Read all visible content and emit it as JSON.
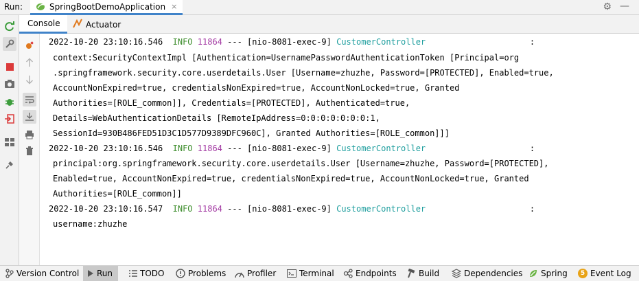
{
  "run_header": {
    "label": "Run:",
    "tab_title": "SpringBootDemoApplication",
    "close_glyph": "×"
  },
  "sub_tabs": [
    {
      "label": "Console",
      "icon": ""
    },
    {
      "label": "Actuator",
      "icon": "actuator-icon"
    }
  ],
  "log": [
    {
      "date": "2022-10-20 23:10:16.546",
      "level": "INFO",
      "pid": "11864",
      "sep": "---",
      "thread": "[nio-8081-exec-9]",
      "logger": "CustomerController",
      "colon": ":"
    },
    {
      "text": "context:SecurityContextImpl [Authentication=UsernamePasswordAuthenticationToken [Principal=org"
    },
    {
      "text": ".springframework.security.core.userdetails.User [Username=zhuzhe, Password=[PROTECTED], Enabled=true,"
    },
    {
      "text": "AccountNonExpired=true, credentialsNonExpired=true, AccountNonLocked=true, Granted"
    },
    {
      "text": "Authorities=[ROLE_common]], Credentials=[PROTECTED], Authenticated=true,"
    },
    {
      "text": "Details=WebAuthenticationDetails [RemoteIpAddress=0:0:0:0:0:0:0:1,"
    },
    {
      "text": "SessionId=930B486FED51D3C1D577D9389DFC960C], Granted Authorities=[ROLE_common]]]"
    },
    {
      "date": "2022-10-20 23:10:16.546",
      "level": "INFO",
      "pid": "11864",
      "sep": "---",
      "thread": "[nio-8081-exec-9]",
      "logger": "CustomerController",
      "colon": ":"
    },
    {
      "text": "principal:org.springframework.security.core.userdetails.User [Username=zhuzhe, Password=[PROTECTED],"
    },
    {
      "text": "Enabled=true, AccountNonExpired=true, credentialsNonExpired=true, AccountNonLocked=true, Granted"
    },
    {
      "text": "Authorities=[ROLE_common]]"
    },
    {
      "date": "2022-10-20 23:10:16.547",
      "level": "INFO",
      "pid": "11864",
      "sep": "---",
      "thread": "[nio-8081-exec-9]",
      "logger": "CustomerController",
      "colon": ":"
    },
    {
      "text": "username:zhuzhe"
    }
  ],
  "bottom_bar": [
    {
      "label": "Version Control",
      "icon": "branch-icon"
    },
    {
      "label": "Run",
      "icon": "play-icon",
      "active": true
    },
    {
      "label": "TODO",
      "icon": "list-icon"
    },
    {
      "label": "Problems",
      "icon": "problems-icon"
    },
    {
      "label": "Profiler",
      "icon": "profiler-icon"
    },
    {
      "label": "Terminal",
      "icon": "terminal-icon"
    },
    {
      "label": "Endpoints",
      "icon": "endpoints-icon"
    },
    {
      "label": "Build",
      "icon": "hammer-icon"
    },
    {
      "label": "Dependencies",
      "icon": "layers-icon"
    },
    {
      "label": "Spring",
      "icon": "spring-leaf-icon"
    },
    {
      "label": "Event Log",
      "icon": "event-log-icon",
      "badge": "5"
    }
  ],
  "colors": {
    "accent": "#4083c9",
    "info": "#3b8c2a",
    "pid": "#a33aa3",
    "logger": "#1e9e9e"
  }
}
